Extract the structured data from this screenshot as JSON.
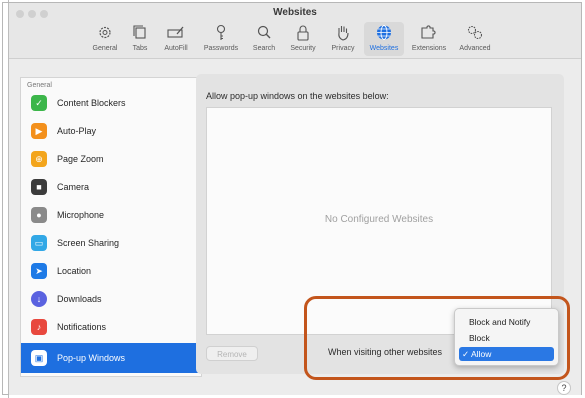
{
  "window": {
    "title": "Websites"
  },
  "tabs": [
    {
      "label": "General",
      "icon": "gear-icon"
    },
    {
      "label": "Tabs",
      "icon": "tabs-icon"
    },
    {
      "label": "AutoFill",
      "icon": "pencil-field-icon"
    },
    {
      "label": "Passwords",
      "icon": "key-icon"
    },
    {
      "label": "Search",
      "icon": "magnifier-icon"
    },
    {
      "label": "Security",
      "icon": "lock-icon"
    },
    {
      "label": "Privacy",
      "icon": "hand-icon"
    },
    {
      "label": "Websites",
      "icon": "globe-icon",
      "active": true
    },
    {
      "label": "Extensions",
      "icon": "puzzle-icon"
    },
    {
      "label": "Advanced",
      "icon": "gears-icon"
    }
  ],
  "sidebar": {
    "header": "General",
    "items": [
      {
        "label": "Content Blockers",
        "icon": "content-blockers-icon",
        "color": "#3cb64a"
      },
      {
        "label": "Auto-Play",
        "icon": "auto-play-icon",
        "color": "#f3901c"
      },
      {
        "label": "Page Zoom",
        "icon": "page-zoom-icon",
        "color": "#f3a51c"
      },
      {
        "label": "Camera",
        "icon": "camera-icon",
        "color": "#3b3b3b"
      },
      {
        "label": "Microphone",
        "icon": "microphone-icon",
        "color": "#8a8a8a"
      },
      {
        "label": "Screen Sharing",
        "icon": "screen-sharing-icon",
        "color": "#32a8e6"
      },
      {
        "label": "Location",
        "icon": "location-icon",
        "color": "#1e7ae6"
      },
      {
        "label": "Downloads",
        "icon": "downloads-icon",
        "color": "#5a62e0"
      },
      {
        "label": "Notifications",
        "icon": "notifications-icon",
        "color": "#e8483e"
      },
      {
        "label": "Pop-up Windows",
        "icon": "popup-windows-icon",
        "color": "#1e6fe0",
        "selected": true
      }
    ]
  },
  "main": {
    "heading": "Allow pop-up windows on the websites below:",
    "empty_text": "No Configured Websites",
    "remove_label": "Remove",
    "visiting_label": "When visiting other websites"
  },
  "dropdown": {
    "options": [
      {
        "label": "Block and Notify",
        "checked": false
      },
      {
        "label": "Block",
        "checked": false
      },
      {
        "label": "✓ Allow",
        "checked": true
      }
    ]
  },
  "help": {
    "label": "?"
  },
  "colors": {
    "accent": "#1e6fe0",
    "highlight_frame": "#c3551c"
  }
}
